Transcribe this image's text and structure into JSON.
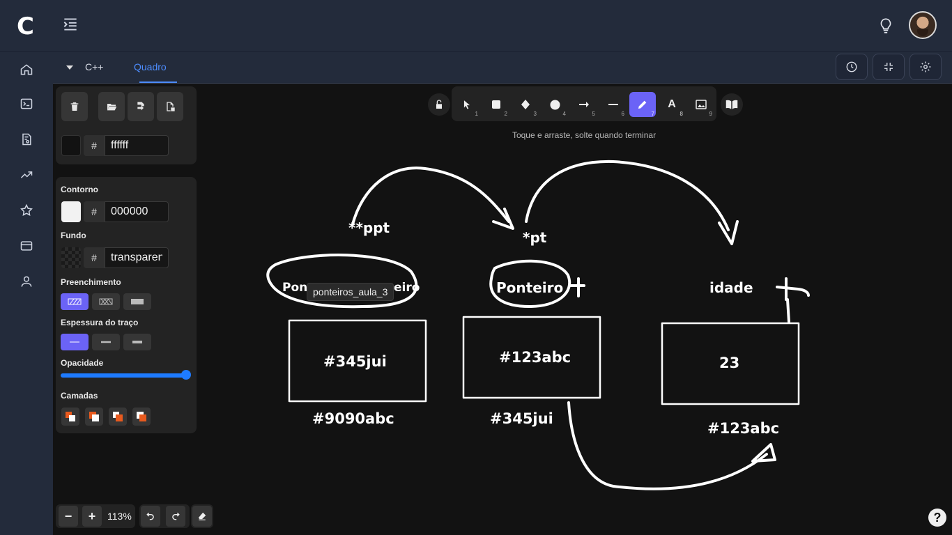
{
  "app": {
    "logo_letter": "C"
  },
  "tabs": [
    {
      "label": "C++",
      "active": false
    },
    {
      "label": "Quadro",
      "active": true
    }
  ],
  "panel": {
    "stroke_color_hex": "ffffff",
    "contorno_label": "Contorno",
    "contorno_hex": "000000",
    "fundo_label": "Fundo",
    "fundo_value": "transparent",
    "preenchimento_label": "Preenchimento",
    "espessura_label": "Espessura do traço",
    "opacidade_label": "Opacidade",
    "opacidade_value": 1.0,
    "camadas_label": "Camadas",
    "hash": "#"
  },
  "toolbar": {
    "hint": "Toque e arraste, solte quando terminar",
    "tools": [
      {
        "name": "select",
        "num": "1"
      },
      {
        "name": "rectangle",
        "num": "2"
      },
      {
        "name": "diamond",
        "num": "3"
      },
      {
        "name": "ellipse",
        "num": "4"
      },
      {
        "name": "arrow",
        "num": "5"
      },
      {
        "name": "line",
        "num": "6"
      },
      {
        "name": "pencil",
        "num": "7",
        "active": true
      },
      {
        "name": "text",
        "num": "8"
      },
      {
        "name": "image",
        "num": "9"
      }
    ]
  },
  "zoom": {
    "value": "113%"
  },
  "canvas": {
    "tooltip": "ponteiros_aula_3",
    "texts": {
      "ppt": "**ppt",
      "pt": "*pt",
      "ponteiro_left": "Pont",
      "ponteiro_left_end": "eiro",
      "ponteiro_mid": "Ponteiro",
      "idade": "idade",
      "box1": "#345jui",
      "box2": "#123abc",
      "box3": "23",
      "addr1": "#9090abc",
      "addr2": "#345jui",
      "addr3": "#123abc"
    }
  },
  "colors": {
    "accent": "#6b63f6",
    "tab_active": "#4d8dff",
    "slider": "#1e7bff"
  },
  "help": "?"
}
